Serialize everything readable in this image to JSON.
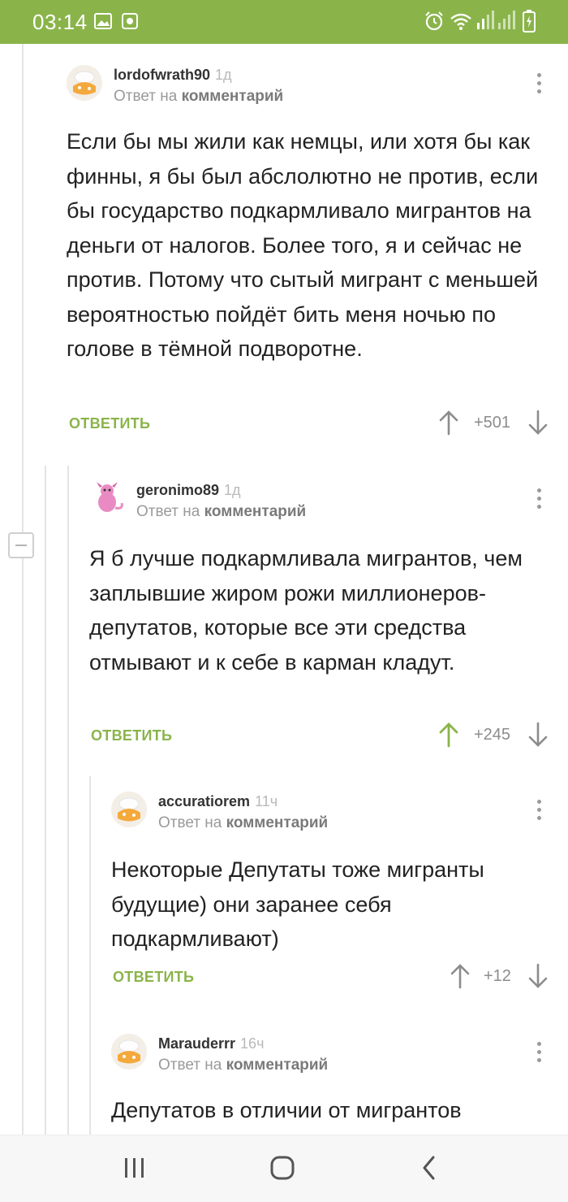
{
  "status_bar": {
    "time": "03:14"
  },
  "comments": [
    {
      "username": "lordofwrath90",
      "time": "1д",
      "reply_prefix": "Ответ на",
      "reply_link": "комментарий",
      "text": "Если бы мы жили как немцы, или хотя бы как финны, я бы был абслолютно не против, если бы государство подкармливало мигрантов на деньги от налогов. Более того, я и сейчас не против. Потому что сытый мигрант с меньшей вероятностью пойдёт бить меня ночью по голове в тёмной подворотне.",
      "reply_label": "ОТВЕТИТЬ",
      "score": "+501"
    },
    {
      "username": "geronimo89",
      "time": "1д",
      "reply_prefix": "Ответ на",
      "reply_link": "комментарий",
      "text": "Я б лучше подкармливала мигрантов, чем заплывшие жиром рожи миллионеров-депутатов, которые все эти средства отмывают и к себе в карман кладут.",
      "reply_label": "ОТВЕТИТЬ",
      "score": "+245",
      "upvoted": true
    },
    {
      "username": "accuratiorem",
      "time": "11ч",
      "reply_prefix": "Ответ на",
      "reply_link": "комментарий",
      "text": "Некоторые Депутаты тоже мигранты будущие) они заранее себя подкармливают)",
      "reply_label": "ОТВЕТИТЬ",
      "score": "+12"
    },
    {
      "username": "Marauderrr",
      "time": "16ч",
      "reply_prefix": "Ответ на",
      "reply_link": "комментарий",
      "text": "Депутатов в отличии от мигрантов"
    }
  ],
  "colors": {
    "accent": "#8ab44a",
    "muted": "#9a9a9a",
    "text": "#222222"
  },
  "icons": {
    "status": [
      "image-icon",
      "notification-icon",
      "alarm-icon",
      "wifi-icon",
      "signal-icon",
      "battery-icon"
    ],
    "nav": [
      "recents-icon",
      "home-icon",
      "back-icon"
    ]
  }
}
